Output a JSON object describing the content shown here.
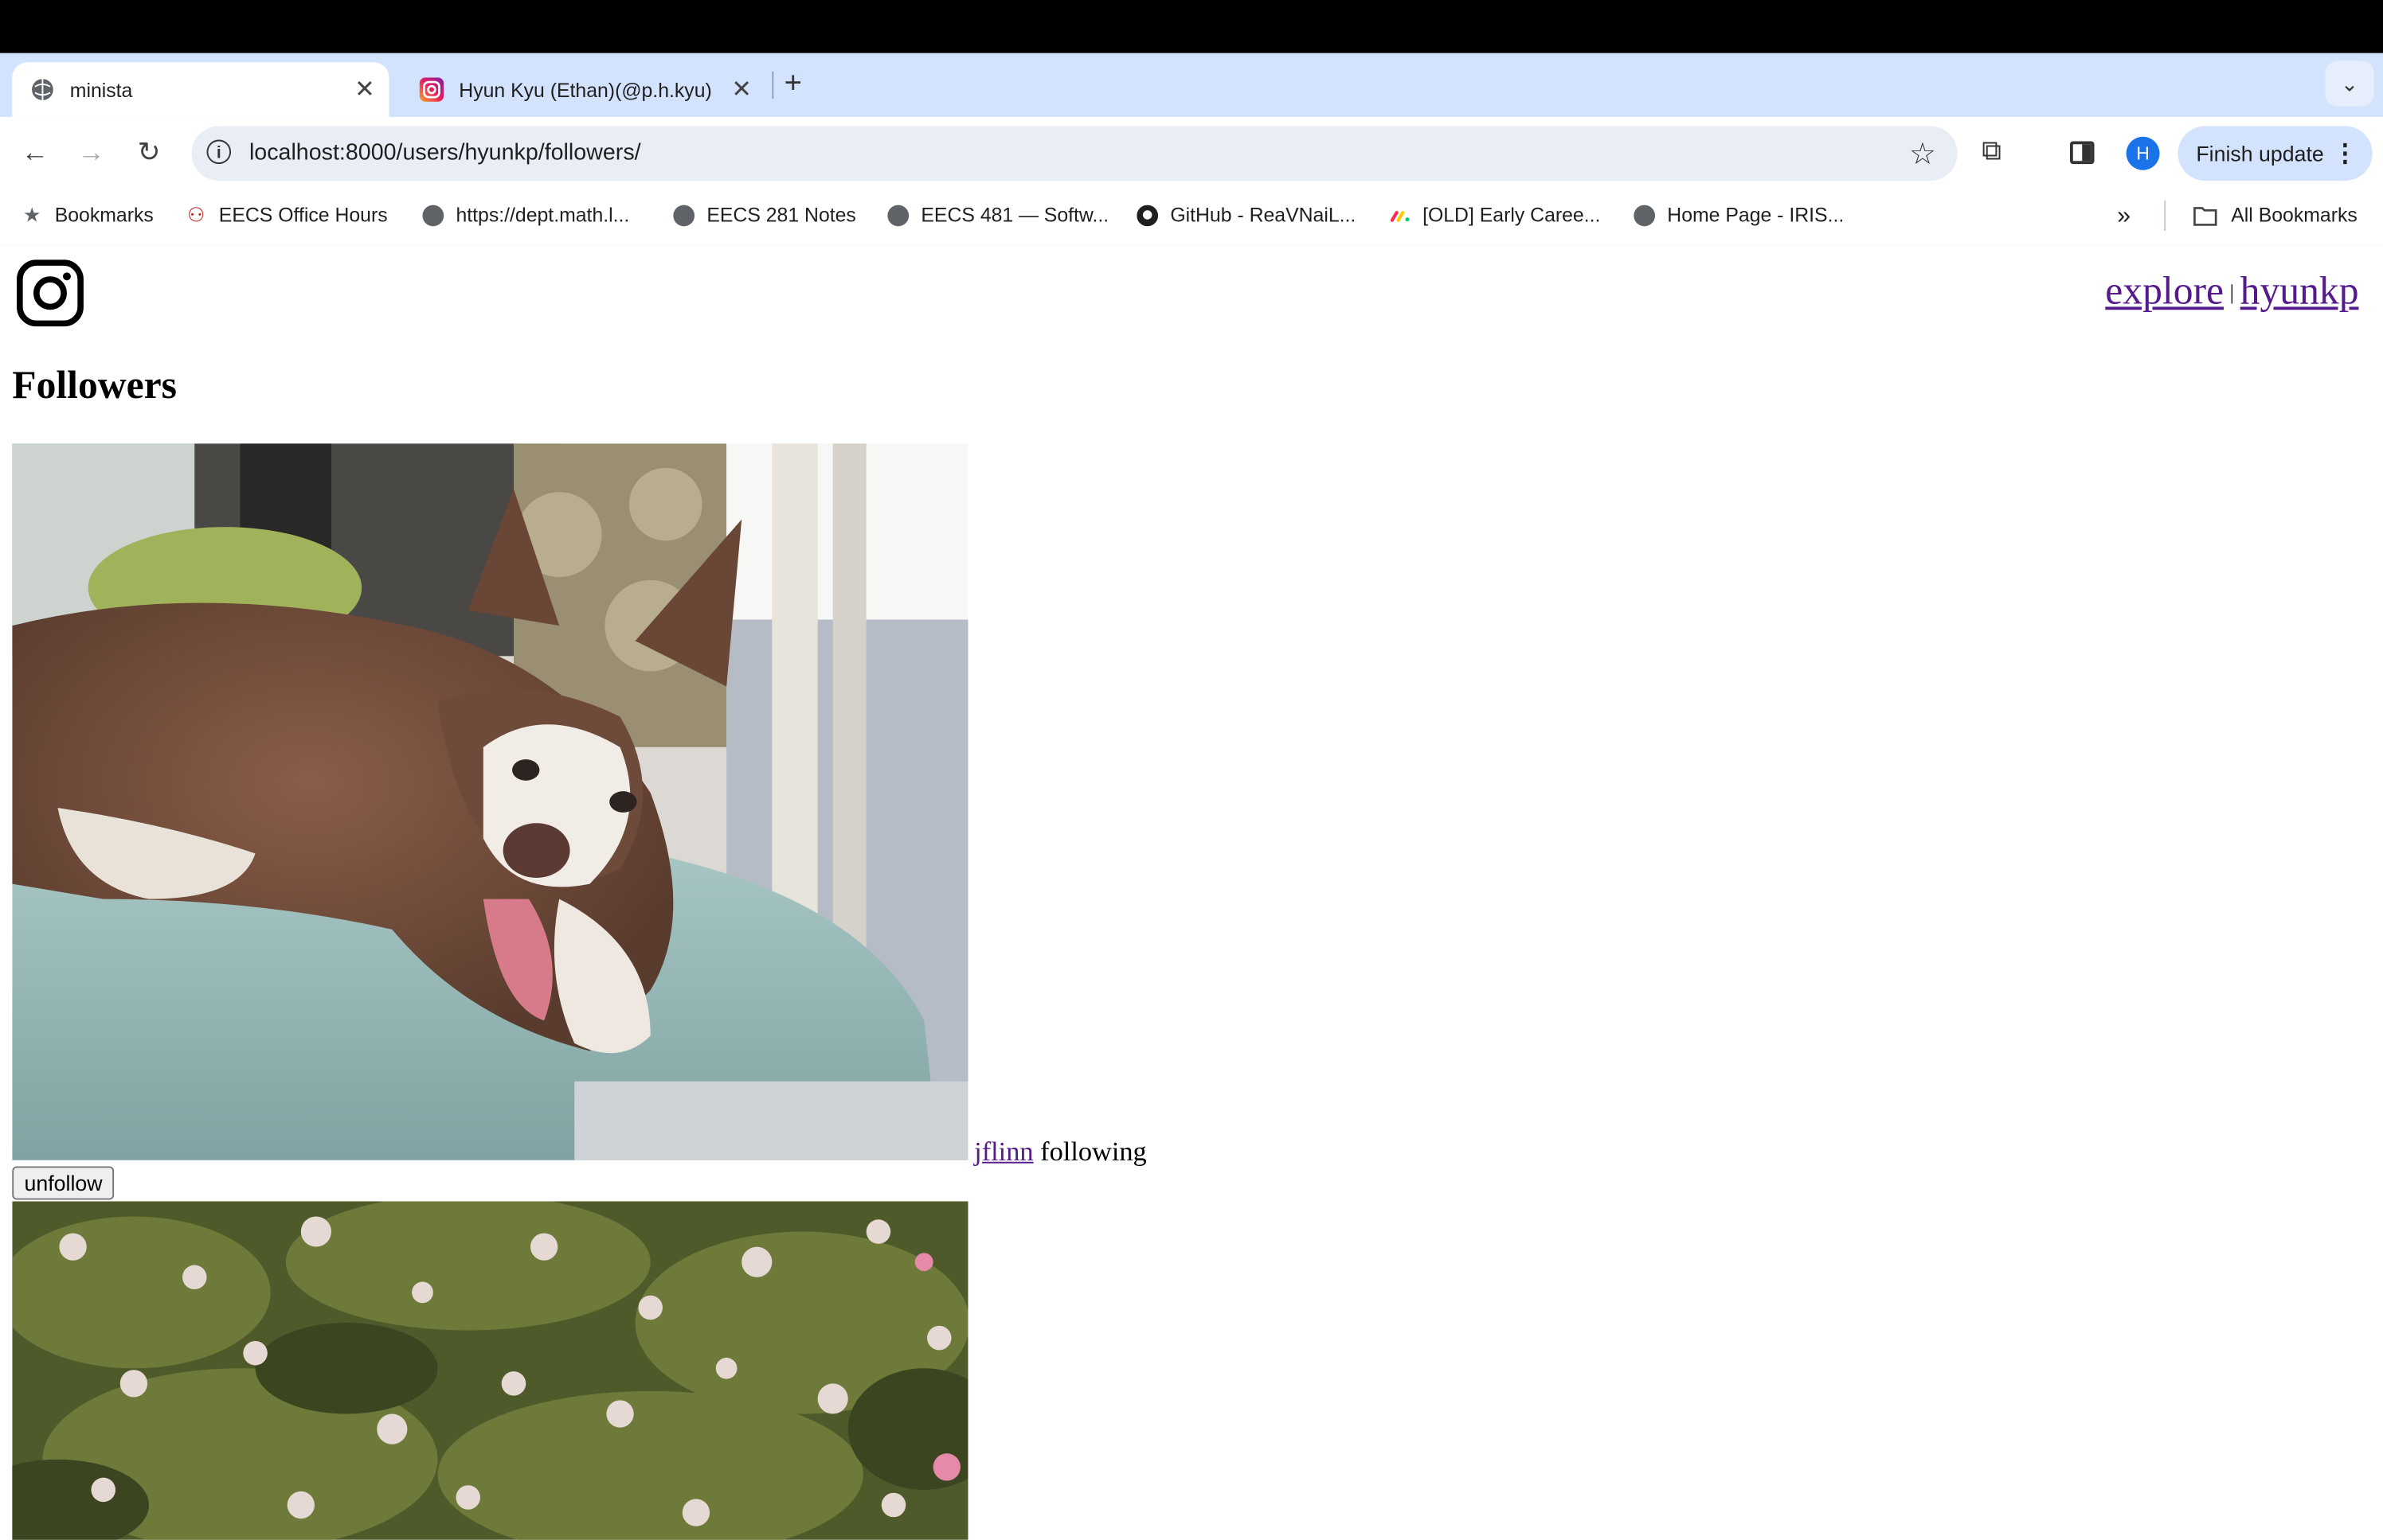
{
  "browser": {
    "tabs": [
      {
        "title": "minista",
        "active": true
      },
      {
        "title": "Hyun Kyu (Ethan)(@p.h.kyu)",
        "active": false
      }
    ],
    "url": "localhost:8000/users/hyunkp/followers/",
    "profile_initial": "H",
    "finish_update_label": "Finish update",
    "bookmarks": [
      {
        "label": "Bookmarks",
        "icon": "star-icon"
      },
      {
        "label": "EECS Office Hours",
        "icon": "people-icon"
      },
      {
        "label": "https://dept.math.l...",
        "icon": "globe-icon"
      },
      {
        "label": "EECS 281 Notes",
        "icon": "globe-icon"
      },
      {
        "label": "EECS 481 — Softw...",
        "icon": "globe-icon"
      },
      {
        "label": "GitHub - ReaVNaiL...",
        "icon": "github-icon"
      },
      {
        "label": "[OLD] Early Caree...",
        "icon": "monday-icon"
      },
      {
        "label": "Home Page - IRIS...",
        "icon": "globe-icon"
      }
    ],
    "all_bookmarks_label": "All Bookmarks"
  },
  "page": {
    "nav": {
      "explore": "explore",
      "user": "hyunkp"
    },
    "heading": "Followers",
    "followers": [
      {
        "username": "jflinn",
        "status": "following",
        "button": "unfollow",
        "photo": "husky puppy on bed"
      },
      {
        "photo": "flowering shrub"
      }
    ]
  }
}
